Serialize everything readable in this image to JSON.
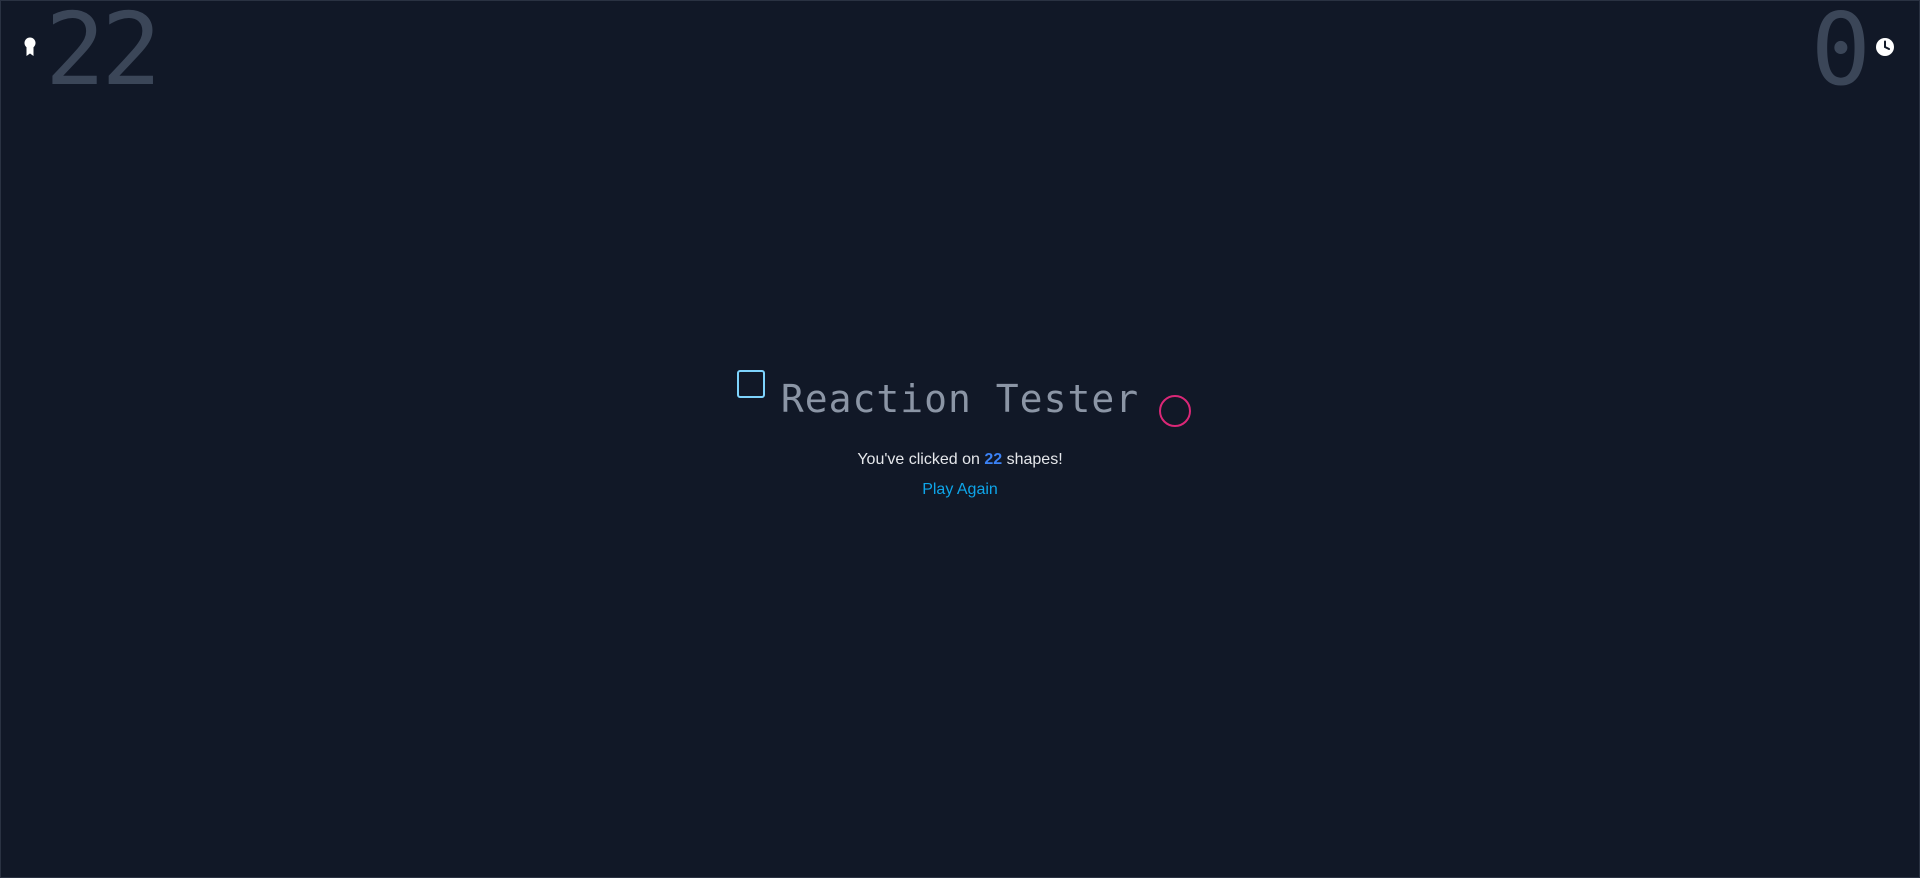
{
  "score": {
    "icon": "award-ribbon-icon",
    "value": "22"
  },
  "timer": {
    "icon": "clock-icon",
    "value": "0"
  },
  "main": {
    "title": "Reaction Tester",
    "message_prefix": "You've clicked on",
    "message_count": "22",
    "message_suffix": "shapes!",
    "play_again_label": "Play Again"
  },
  "colors": {
    "background": "#111827",
    "number": "#3b4658",
    "square": "#7dd3fc",
    "circle": "#db2777",
    "link": "#0ea5e9",
    "count": "#3b82f6"
  }
}
